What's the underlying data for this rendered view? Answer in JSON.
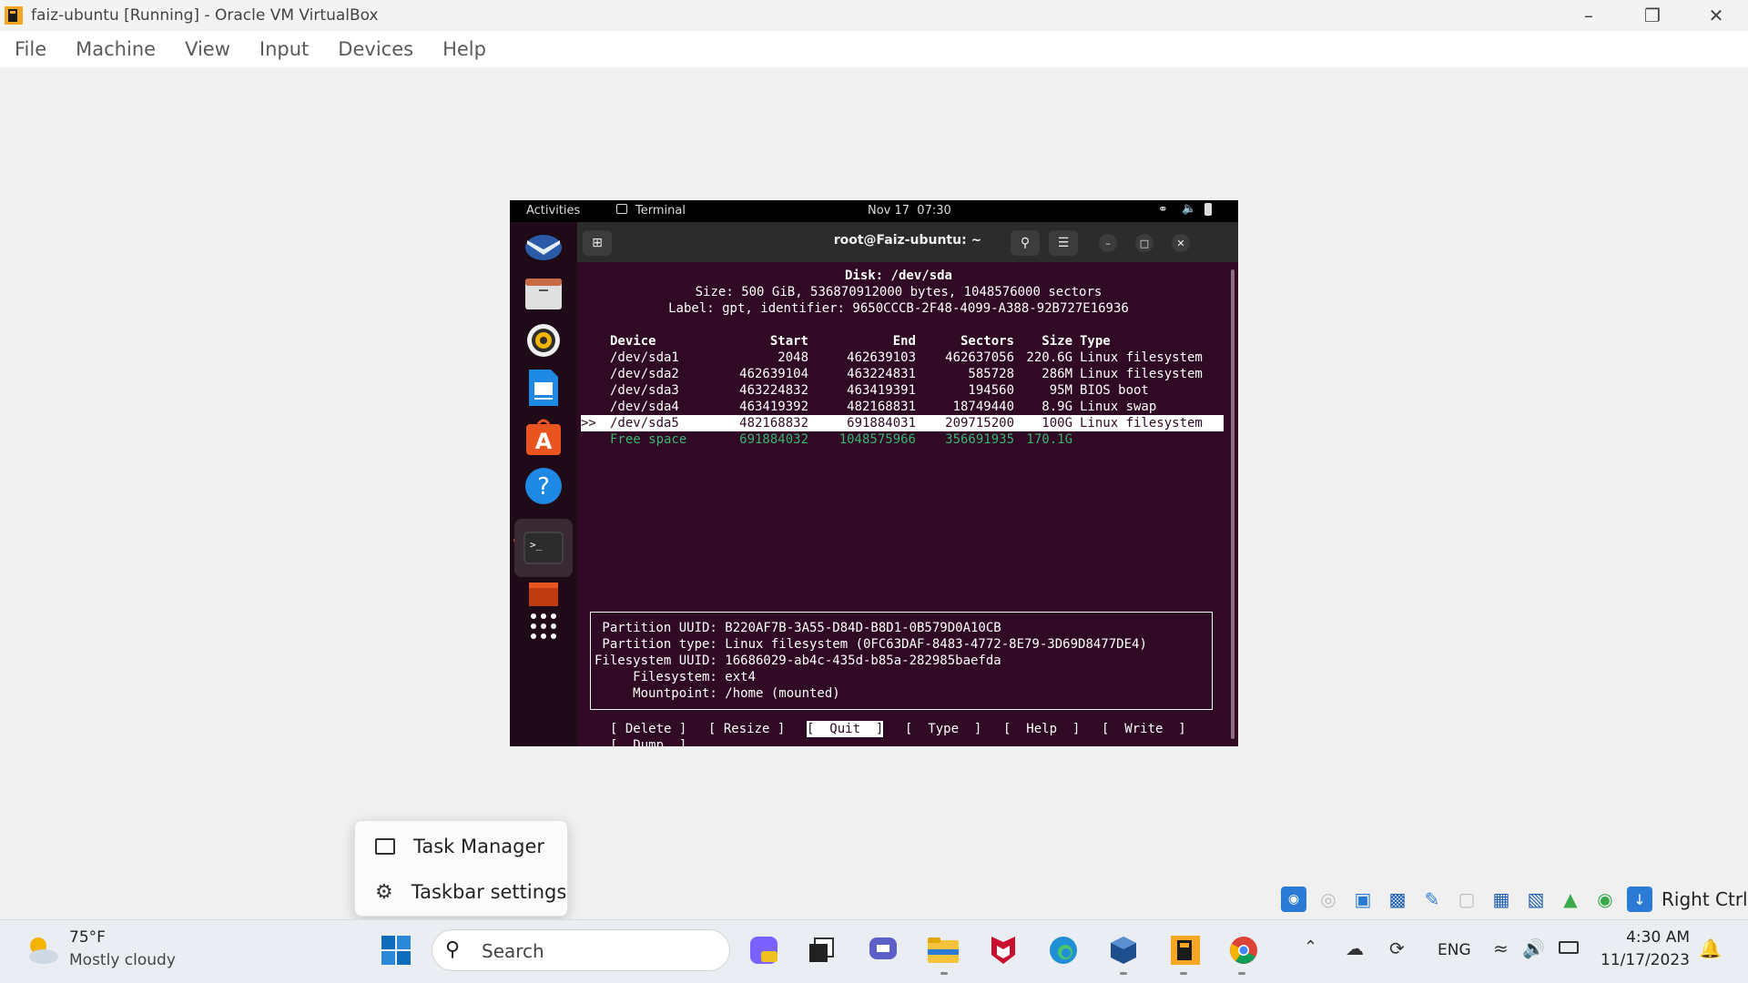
{
  "window": {
    "title": "faiz-ubuntu [Running] - Oracle VM VirtualBox",
    "minimize_icon": "minimize-icon",
    "restore_icon": "restore-icon",
    "close_icon": "close-icon"
  },
  "menubar": {
    "items": [
      "File",
      "Machine",
      "View",
      "Input",
      "Devices",
      "Help"
    ]
  },
  "ubuntu": {
    "topbar": {
      "activities": "Activities",
      "app": "Terminal",
      "clock": "Nov 17  07:30"
    },
    "dock": [
      "thunderbird-icon",
      "files-icon",
      "rhythmbox-icon",
      "writer-icon",
      "app-center-icon",
      "help-icon",
      "terminal-icon",
      "trash-icon",
      "app-grid-icon"
    ],
    "terminal": {
      "title": "root@Faiz-ubuntu: ~",
      "disk_title": "Disk: /dev/sda",
      "disk_size": "Size: 500 GiB, 536870912000 bytes, 1048576000 sectors",
      "disk_label": "Label: gpt, identifier: 9650CCCB-2F48-4099-A388-92B727E16936",
      "headers": {
        "device": "Device",
        "start": "Start",
        "end": "End",
        "sectors": "Sectors",
        "size": "Size",
        "type": "Type"
      },
      "rows": [
        {
          "marker": "",
          "device": "/dev/sda1",
          "start": "2048",
          "end": "462639103",
          "sectors": "462637056",
          "size": "220.6G",
          "type": "Linux filesystem"
        },
        {
          "marker": "",
          "device": "/dev/sda2",
          "start": "462639104",
          "end": "463224831",
          "sectors": "585728",
          "size": "286M",
          "type": "Linux filesystem"
        },
        {
          "marker": "",
          "device": "/dev/sda3",
          "start": "463224832",
          "end": "463419391",
          "sectors": "194560",
          "size": "95M",
          "type": "BIOS boot"
        },
        {
          "marker": "",
          "device": "/dev/sda4",
          "start": "463419392",
          "end": "482168831",
          "sectors": "18749440",
          "size": "8.9G",
          "type": "Linux swap"
        },
        {
          "marker": ">>",
          "device": "/dev/sda5",
          "start": "482168832",
          "end": "691884031",
          "sectors": "209715200",
          "size": "100G",
          "type": "Linux filesystem"
        }
      ],
      "free": {
        "device": "Free space",
        "start": "691884032",
        "end": "1048575966",
        "sectors": "356691935",
        "size": "170.1G"
      },
      "info": [
        " Partition UUID: B220AF7B-3A55-D84D-B8D1-0B579D0A10CB",
        " Partition type: Linux filesystem (0FC63DAF-8483-4772-8E79-3D69D8477DE4)",
        "Filesystem UUID: 16686029-ab4c-435d-b85a-282985baefda",
        "     Filesystem: ext4",
        "     Mountpoint: /home (mounted)"
      ],
      "buttons": [
        "[ Delete ]",
        "[ Resize ]",
        "[  Quit  ]",
        "[  Type  ]",
        "[  Help  ]",
        "[  Write  ]",
        "[  Dump  ]"
      ]
    }
  },
  "context_menu": {
    "items": [
      "Task Manager",
      "Taskbar settings"
    ]
  },
  "vbox_status": {
    "host_key": "Right Ctrl"
  },
  "taskbar": {
    "weather_temp": "75°F",
    "weather_desc": "Mostly cloudy",
    "search_placeholder": "Search",
    "lang": "ENG",
    "time": "4:30 AM",
    "date": "11/17/2023"
  }
}
